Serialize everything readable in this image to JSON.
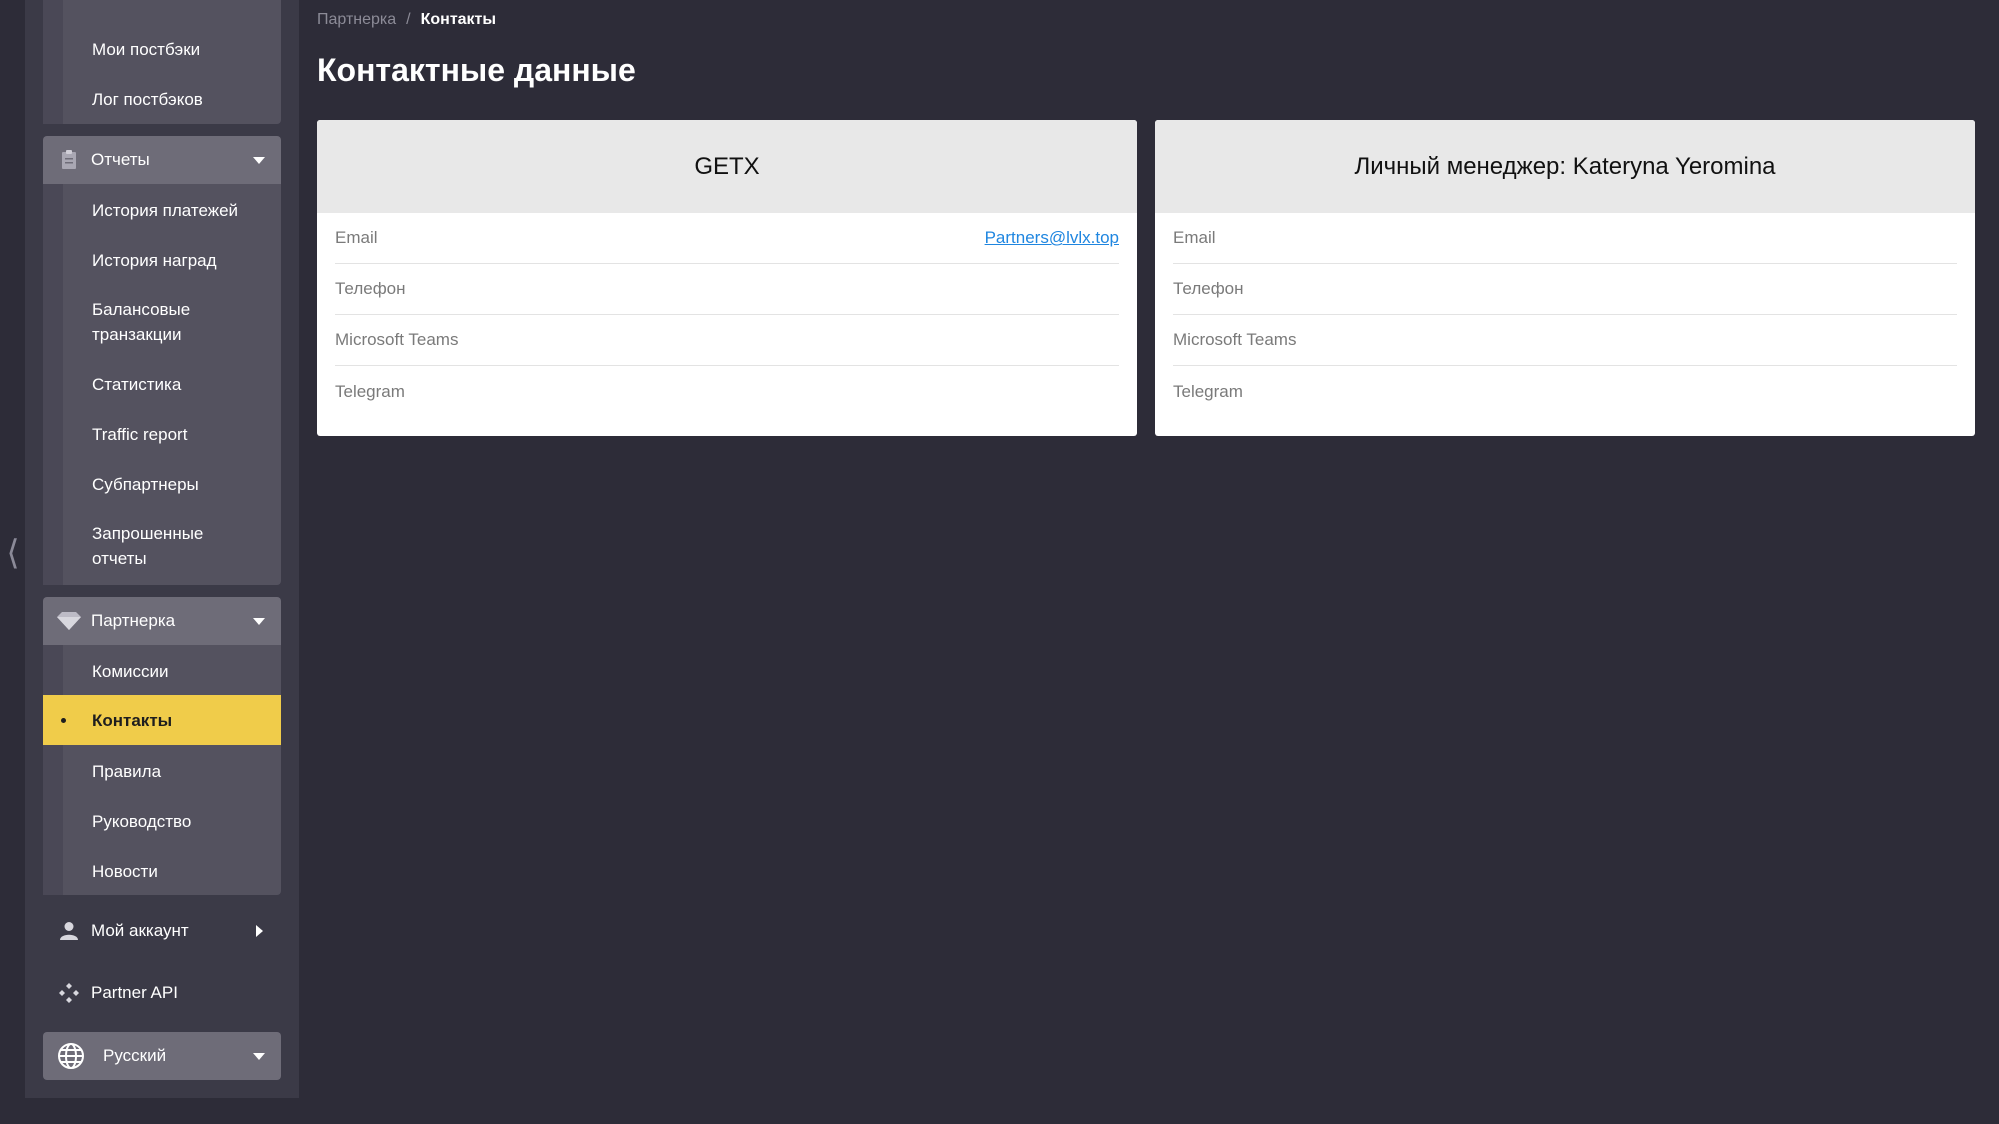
{
  "sidebar": {
    "postbacks": [
      "Мои постбэки",
      "Лог постбэков"
    ],
    "reports": {
      "label": "Отчеты",
      "items": [
        "История платежей",
        "История наград",
        "Балансовые\nтранзакции",
        "Статистика",
        "Traffic report",
        "Субпартнеры",
        "Запрошенные\nотчеты"
      ]
    },
    "partner": {
      "label": "Партнерка",
      "items": [
        "Комиссии",
        "Контакты",
        "Правила",
        "Руководство",
        "Новости"
      ],
      "active_item": "Контакты"
    },
    "account_label": "Мой аккаунт",
    "api_label": "Partner API",
    "language": "Русский"
  },
  "breadcrumb": {
    "parent": "Партнерка",
    "separator": "/",
    "current": "Контакты"
  },
  "page_title": "Контактные данные",
  "cards": [
    {
      "title": "GETX",
      "rows": [
        {
          "label": "Email",
          "value": "Partners@lvlx.top"
        },
        {
          "label": "Телефон",
          "value": ""
        },
        {
          "label": "Microsoft Teams",
          "value": ""
        },
        {
          "label": "Telegram",
          "value": ""
        }
      ]
    },
    {
      "title": "Личный менеджер: Kateryna Yeromina",
      "rows": [
        {
          "label": "Email",
          "value": ""
        },
        {
          "label": "Телефон",
          "value": ""
        },
        {
          "label": "Microsoft Teams",
          "value": ""
        },
        {
          "label": "Telegram",
          "value": ""
        }
      ]
    }
  ],
  "colors": {
    "active": "#f0cc4a",
    "link": "#1f86e0",
    "background": "#2d2c38"
  }
}
